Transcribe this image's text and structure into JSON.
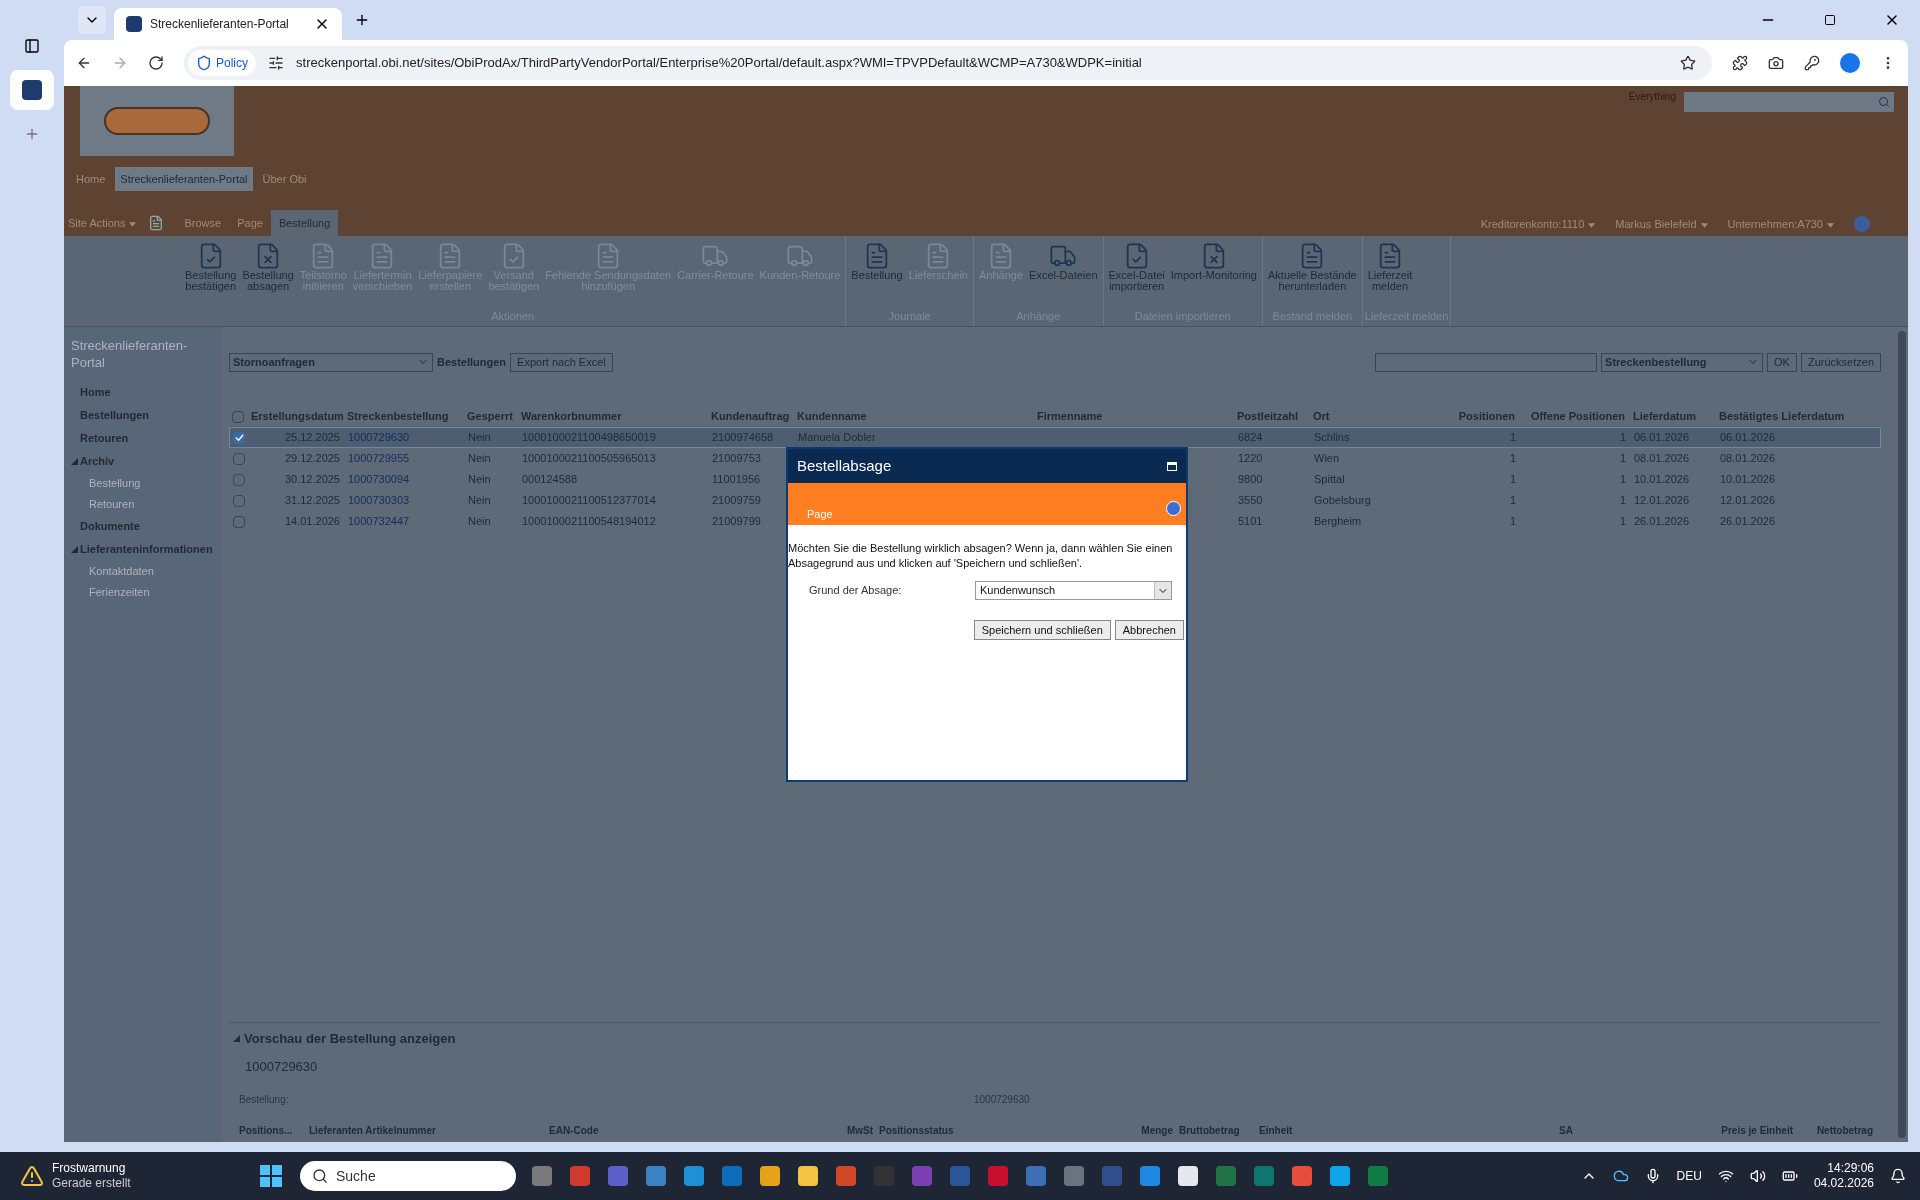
{
  "browser": {
    "tab_title": "Streckenlieferanten-Portal",
    "policy": "Policy",
    "url": "streckenportal.obi.net/sites/ObiProdAx/ThirdPartyVendorPortal/Enterprise%20Portal/default.aspx?WMI=TPVPDefault&WCMP=A730&WDPK=initial"
  },
  "header": {
    "search_label": "Everything",
    "nav": [
      {
        "label": "Home",
        "selected": false
      },
      {
        "label": "Streckenlieferanten-Portal",
        "selected": true
      },
      {
        "label": "Über Obi",
        "selected": false
      }
    ],
    "site_actions": "Site Actions",
    "ribbon_tabs": [
      {
        "label": "Browse",
        "selected": false
      },
      {
        "label": "Page",
        "selected": false
      },
      {
        "label": "Bestellung",
        "selected": true
      }
    ],
    "user_menu": [
      "Kreditorenkonto:1110",
      "Markus Bielefeld",
      "Unternehmen:A730"
    ]
  },
  "ribbon": [
    {
      "label": "Aktionen",
      "buttons": [
        {
          "lines": [
            "Bestellung",
            "bestätigen"
          ],
          "disabled": false
        },
        {
          "lines": [
            "Bestellung",
            "absagen"
          ],
          "disabled": false
        },
        {
          "lines": [
            "Teilstorno",
            "initiieren"
          ],
          "disabled": true
        },
        {
          "lines": [
            "Liefertermin",
            "verschieben"
          ],
          "disabled": true
        },
        {
          "lines": [
            "Lieferpapiere",
            "erstellen"
          ],
          "disabled": true
        },
        {
          "lines": [
            "Versand",
            "bestätigen"
          ],
          "disabled": true
        },
        {
          "lines": [
            "Fehlende Sendungsdaten",
            "hinzufügen"
          ],
          "disabled": true
        },
        {
          "lines": [
            "Carrier-Retoure"
          ],
          "disabled": true
        },
        {
          "lines": [
            "Kunden-Retoure"
          ],
          "disabled": true
        }
      ]
    },
    {
      "label": "Journale",
      "buttons": [
        {
          "lines": [
            "Bestellung"
          ],
          "disabled": false
        },
        {
          "lines": [
            "Lieferschein"
          ],
          "disabled": true
        }
      ]
    },
    {
      "label": "Anhänge",
      "buttons": [
        {
          "lines": [
            "Anhänge"
          ],
          "disabled": true
        },
        {
          "lines": [
            "Excel-Dateien"
          ],
          "disabled": false
        }
      ]
    },
    {
      "label": "Dateien importieren",
      "buttons": [
        {
          "lines": [
            "Excel-Datei",
            "importieren"
          ],
          "disabled": false
        },
        {
          "lines": [
            "Import-Monitoring"
          ],
          "disabled": false
        }
      ]
    },
    {
      "label": "Bestand melden",
      "buttons": [
        {
          "lines": [
            "Aktuelle Bestände",
            "herunterladen"
          ],
          "disabled": false
        }
      ]
    },
    {
      "label": "Lieferzeit melden",
      "buttons": [
        {
          "lines": [
            "Lieferzeit",
            "melden"
          ],
          "disabled": false
        }
      ]
    }
  ],
  "sidebar": {
    "title": "Streckenlieferanten-Portal",
    "items": [
      {
        "label": "Home"
      },
      {
        "label": "Bestellungen"
      },
      {
        "label": "Retouren"
      },
      {
        "label": "Archiv",
        "expanded": true,
        "children": [
          {
            "label": "Bestellung"
          },
          {
            "label": "Retouren"
          }
        ]
      },
      {
        "label": "Dokumente"
      },
      {
        "label": "Lieferanteninformationen",
        "expanded": true,
        "children": [
          {
            "label": "Kontaktdaten"
          },
          {
            "label": "Ferienzeiten"
          }
        ]
      }
    ]
  },
  "toolbar": {
    "view": "Stornoanfragen",
    "view_label": "Bestellungen",
    "export": "Export nach Excel",
    "search_field": "Streckenbestellung",
    "ok": "OK",
    "reset": "Zurücksetzen"
  },
  "table": {
    "select_all_checked": false,
    "columns": [
      "Erstellungsdatum",
      "Streckenbestellung",
      "Gesperrt",
      "Warenkorbnummer",
      "Kundenauftrag",
      "Kundenname",
      "Firmenname",
      "Postleitzahl",
      "Ort",
      "Positionen",
      "Offene Positionen",
      "Lieferdatum",
      "Bestätigtes Lieferdatum"
    ],
    "rows": [
      {
        "selected": true,
        "cells": [
          "25.12.2025",
          "1000729630",
          "Nein",
          "1000100021100498650019",
          "2100974658",
          "Manuela Dobler",
          "",
          "6824",
          "Schlins",
          "1",
          "1",
          "06.01.2026",
          "06.01.2026"
        ]
      },
      {
        "selected": false,
        "cells": [
          "29.12.2025",
          "1000729955",
          "Nein",
          "1000100021100505965013",
          "21009753",
          "",
          "",
          "1220",
          "Wien",
          "1",
          "1",
          "08.01.2026",
          "08.01.2026"
        ]
      },
      {
        "selected": false,
        "cells": [
          "30.12.2025",
          "1000730094",
          "Nein",
          "000124588",
          "11001956",
          "",
          "",
          "9800",
          "Spittal",
          "1",
          "1",
          "10.01.2026",
          "10.01.2026"
        ]
      },
      {
        "selected": false,
        "cells": [
          "31.12.2025",
          "1000730303",
          "Nein",
          "1000100021100512377014",
          "21009759",
          "",
          "",
          "3550",
          "Gobelsburg",
          "1",
          "1",
          "12.01.2026",
          "12.01.2026"
        ]
      },
      {
        "selected": false,
        "cells": [
          "14.01.2026",
          "1000732447",
          "Nein",
          "1000100021100548194012",
          "21009799",
          "",
          "",
          "5101",
          "Bergheim",
          "1",
          "1",
          "26.01.2026",
          "26.01.2026"
        ]
      }
    ]
  },
  "preview": {
    "title": "Vorschau der Bestellung anzeigen",
    "expanded": true,
    "number": "1000729630",
    "field_label": "Bestellung:",
    "field_value": "1000729630",
    "columns": [
      "Positions...",
      "Lieferanten Artikelnummer",
      "EAN-Code",
      "MwSt",
      "Positionsstatus",
      "Menge",
      "Bruttobetrag",
      "Einheit",
      "SA",
      "Preis je Einheit",
      "Nettobetrag"
    ]
  },
  "dialog": {
    "title": "Bestellabsage",
    "subtitle": "Page",
    "message": "Möchten Sie die Bestellung wirklich absagen? Wenn ja, dann wählen Sie einen Absagegrund aus und klicken auf 'Speichern und schließen'.",
    "field_label": "Grund der Absage:",
    "field_value": "Kundenwunsch",
    "buttons": [
      "Speichern und schließen",
      "Abbrechen"
    ]
  },
  "taskbar": {
    "notification_title": "Frostwarnung",
    "notification_text": "Gerade erstellt",
    "search": "Suche",
    "language": "DEU",
    "time": "14:29:06",
    "date": "04.02.2026"
  }
}
